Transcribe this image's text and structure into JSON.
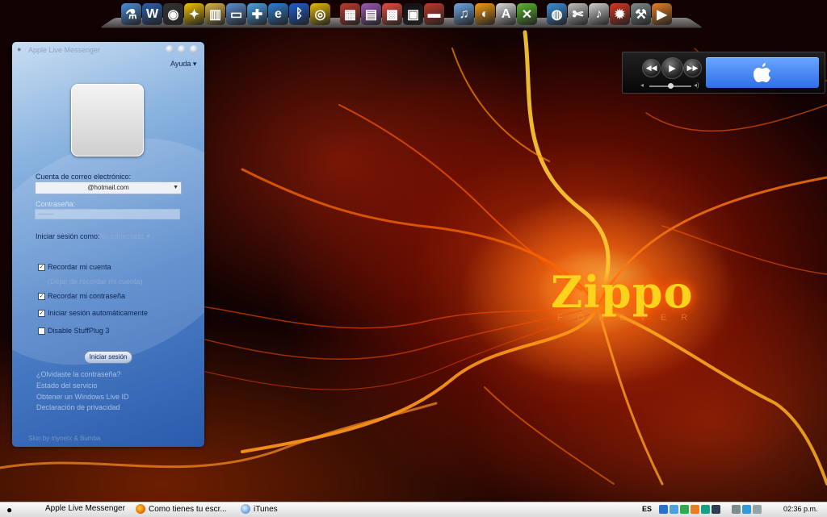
{
  "desktop": {
    "wallpaper_logo": "Zippo",
    "wallpaper_subtitle": "FOREVER"
  },
  "dock": {
    "icons": [
      {
        "name": "flask-icon",
        "color": "#4a8fd9",
        "glyph": "⚗"
      },
      {
        "name": "word-icon",
        "color": "#2b5fb0",
        "glyph": "W"
      },
      {
        "name": "ipod-icon",
        "color": "#333333",
        "glyph": "◉"
      },
      {
        "name": "messenger-icon",
        "color": "#f2c200",
        "glyph": "✦"
      },
      {
        "name": "book-icon",
        "color": "#d9b44a",
        "glyph": "▥"
      },
      {
        "name": "computer-icon",
        "color": "#5a8fd0",
        "glyph": "▭"
      },
      {
        "name": "live-messenger-icon",
        "color": "#49a3e6",
        "glyph": "✚"
      },
      {
        "name": "internet-explorer-icon",
        "color": "#2d7fd2",
        "glyph": "e"
      },
      {
        "name": "bluetooth-icon",
        "color": "#1e5fd0",
        "glyph": "ᛒ"
      },
      {
        "name": "ring-icon",
        "color": "#e6b800",
        "glyph": "◎"
      },
      {
        "name": "keyboard-icon",
        "color": "#c0392b",
        "glyph": "▦"
      },
      {
        "name": "winrar-icon",
        "color": "#9b59b6",
        "glyph": "▤"
      },
      {
        "name": "film-icon",
        "color": "#e74c3c",
        "glyph": "▩"
      },
      {
        "name": "calendar-icon",
        "color": "#111111",
        "glyph": "▣"
      },
      {
        "name": "flag-icon",
        "color": "#c0392b",
        "glyph": "▬"
      },
      {
        "name": "itunes-icon",
        "color": "#6fa8e6",
        "glyph": "♫"
      },
      {
        "name": "firefox-icon",
        "color": "#f39c12",
        "glyph": "◐"
      },
      {
        "name": "astro-icon",
        "color": "#dcdcdc",
        "glyph": "A"
      },
      {
        "name": "xbox-icon",
        "color": "#5bb82e",
        "glyph": "✕"
      },
      {
        "name": "network-icon",
        "color": "#3a8fd9",
        "glyph": "◍"
      },
      {
        "name": "tools-icon",
        "color": "#c0c0c0",
        "glyph": "✄"
      },
      {
        "name": "guitar-icon",
        "color": "#d0d0d0",
        "glyph": "♪"
      },
      {
        "name": "fire-icon",
        "color": "#d9341e",
        "glyph": "✹"
      },
      {
        "name": "tool-icon",
        "color": "#7f8c8d",
        "glyph": "⚒"
      },
      {
        "name": "media-icon",
        "color": "#e67e22",
        "glyph": "▶"
      }
    ]
  },
  "messenger": {
    "title": "Apple Live Messenger",
    "help_menu": "Ayuda",
    "email_label": "Cuenta de correo electrónico:",
    "email_value": "@hotmail.com",
    "password_label": "Contraseña:",
    "password_value": "••••••••",
    "status_label": "Iniciar sesión como:",
    "status_value": "No conectado",
    "remember_account": "Recordar mi cuenta",
    "forget_account": "(Dejar de recordar mi cuenta)",
    "remember_password": "Recordar mi contraseña",
    "auto_signin": "Iniciar sesión automáticamente",
    "disable_stuffplug": "Disable StuffPlug 3",
    "signin_button": "Iniciar sesión",
    "links": [
      "¿Olvidaste la contraseña?",
      "Estado del servicio",
      "Obtener un Windows Live ID",
      "Declaración de privacidad"
    ],
    "skin_credit": "Skin by mynetx & Bumba",
    "checkboxes": {
      "remember_account": true,
      "remember_password": true,
      "auto_signin": true,
      "disable_stuffplug": false
    }
  },
  "player": {
    "display_icon": "apple-icon"
  },
  "taskbar": {
    "tasks": [
      {
        "label": "Apple Live Messenger",
        "icon": "apple-icon"
      },
      {
        "label": "Como tienes tu escr...",
        "icon": "firefox-icon"
      },
      {
        "label": "iTunes",
        "icon": "itunes-icon"
      }
    ],
    "language": "ES",
    "clock": "02:36 p.m."
  }
}
